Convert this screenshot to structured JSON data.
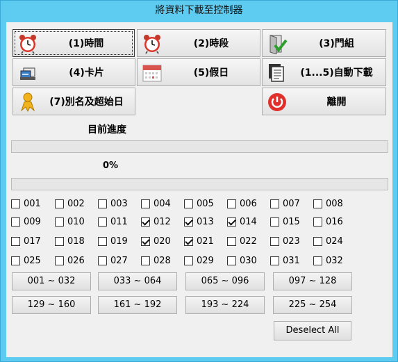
{
  "window": {
    "title": "將資料下載至控制器"
  },
  "buttons": [
    {
      "id": "time",
      "label": "(1)時間",
      "icon": "alarm-clock-icon"
    },
    {
      "id": "period",
      "label": "(2)時段",
      "icon": "alarm-clock-icon"
    },
    {
      "id": "door-group",
      "label": "(3)門組",
      "icon": "door-check-icon"
    },
    {
      "id": "card",
      "label": "(4)卡片",
      "icon": "card-reader-icon"
    },
    {
      "id": "holiday",
      "label": "(5)假日",
      "icon": "calendar-icon"
    },
    {
      "id": "auto-download",
      "label": "(1...5)自動下載",
      "icon": "documents-icon"
    },
    {
      "id": "alias",
      "label": "(7)別名及超始日",
      "icon": "person-icon"
    },
    {
      "id": "exit",
      "label": "離開",
      "icon": "power-icon"
    }
  ],
  "progress": {
    "label": "目前進度",
    "current_percent": 0,
    "percent_text": "0%",
    "overall_percent": 0
  },
  "controllers": [
    {
      "label": "001",
      "checked": false
    },
    {
      "label": "002",
      "checked": false
    },
    {
      "label": "003",
      "checked": false
    },
    {
      "label": "004",
      "checked": false
    },
    {
      "label": "005",
      "checked": false
    },
    {
      "label": "006",
      "checked": false
    },
    {
      "label": "007",
      "checked": false
    },
    {
      "label": "008",
      "checked": false
    },
    {
      "label": "009",
      "checked": false
    },
    {
      "label": "010",
      "checked": false
    },
    {
      "label": "011",
      "checked": false
    },
    {
      "label": "012",
      "checked": true
    },
    {
      "label": "013",
      "checked": true
    },
    {
      "label": "014",
      "checked": true
    },
    {
      "label": "015",
      "checked": false
    },
    {
      "label": "016",
      "checked": false
    },
    {
      "label": "017",
      "checked": false
    },
    {
      "label": "018",
      "checked": false
    },
    {
      "label": "019",
      "checked": false
    },
    {
      "label": "020",
      "checked": true
    },
    {
      "label": "021",
      "checked": true
    },
    {
      "label": "022",
      "checked": false
    },
    {
      "label": "023",
      "checked": false
    },
    {
      "label": "024",
      "checked": false
    },
    {
      "label": "025",
      "checked": false
    },
    {
      "label": "026",
      "checked": false
    },
    {
      "label": "027",
      "checked": false
    },
    {
      "label": "028",
      "checked": false
    },
    {
      "label": "029",
      "checked": false
    },
    {
      "label": "030",
      "checked": false
    },
    {
      "label": "031",
      "checked": false
    },
    {
      "label": "032",
      "checked": false
    }
  ],
  "ranges": [
    "001 ~ 032",
    "033 ~ 064",
    "065 ~ 096",
    "097 ~ 128",
    "129 ~ 160",
    "161 ~ 192",
    "193 ~ 224",
    "225 ~ 254"
  ],
  "deselect_label": "Deselect All"
}
